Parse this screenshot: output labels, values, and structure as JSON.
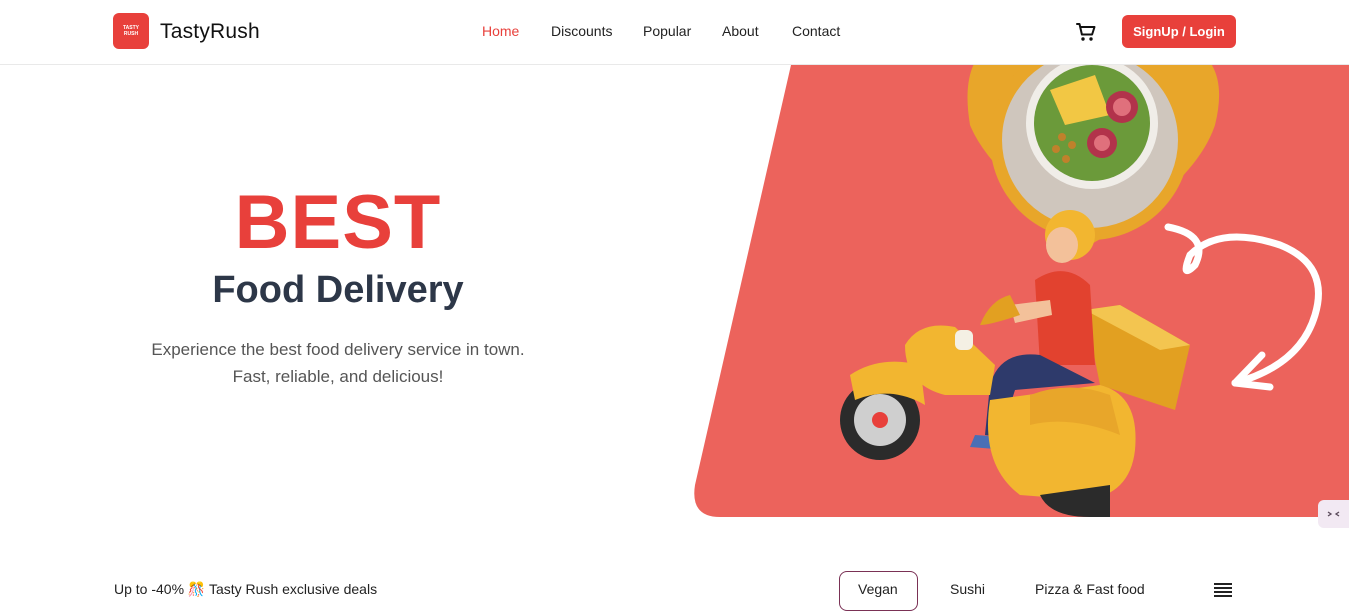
{
  "header": {
    "logo_text": "TASTY RUSH",
    "brand": "TastyRush",
    "nav": [
      "Home",
      "Discounts",
      "Popular",
      "About",
      "Contact"
    ],
    "signup_label": "SignUp / Login"
  },
  "hero": {
    "title": "BEST",
    "subtitle": "Food Delivery",
    "desc_line1": "Experience the best food delivery service in town.",
    "desc_line2": "Fast, reliable, and delicious!"
  },
  "colors": {
    "accent": "#e8403b",
    "hero_bg": "#ec635c",
    "pin": "#e8a62a",
    "scooter": "#f2b630"
  },
  "deals": {
    "text": "Up to -40% 🎊 Tasty Rush exclusive deals",
    "categories": [
      "Vegan",
      "Sushi",
      "Pizza & Fast food"
    ]
  }
}
